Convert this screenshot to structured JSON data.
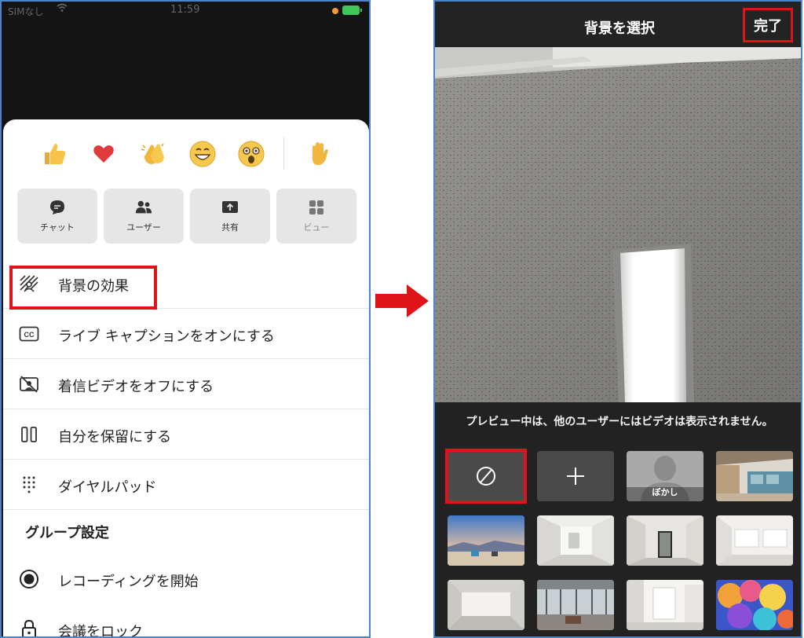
{
  "left_phone": {
    "status_bar": {
      "carrier": "SIMなし",
      "time": "11:59"
    },
    "reactions": [
      "thumbs-up",
      "heart",
      "clapping-hands",
      "laughing-face",
      "surprised-face",
      "raised-hand"
    ],
    "tiles": [
      {
        "label": "チャット",
        "icon": "chat-icon"
      },
      {
        "label": "ユーザー",
        "icon": "people-icon"
      },
      {
        "label": "共有",
        "icon": "share-icon"
      },
      {
        "label": "ビュー",
        "icon": "grid-icon",
        "disabled": true
      }
    ],
    "menu": [
      {
        "label": "背景の効果",
        "icon": "background-effects-icon"
      },
      {
        "label": "ライブ キャプションをオンにする",
        "icon": "closed-caption-icon"
      },
      {
        "label": "着信ビデオをオフにする",
        "icon": "video-off-icon"
      },
      {
        "label": "自分を保留にする",
        "icon": "pause-icon"
      },
      {
        "label": "ダイヤルパッド",
        "icon": "dialpad-icon"
      }
    ],
    "group_heading": "グループ設定",
    "group_menu": [
      {
        "label": "レコーディングを開始",
        "icon": "record-icon"
      },
      {
        "label": "会議をロック",
        "icon": "lock-icon"
      }
    ]
  },
  "right_phone": {
    "title": "背景を選択",
    "done_label": "完了",
    "notice": "プレビュー中は、他のユーザーにはビデオは表示されません。",
    "options": [
      {
        "kind": "none",
        "icon": "no-background-icon"
      },
      {
        "kind": "add",
        "icon": "plus-icon"
      },
      {
        "kind": "blur",
        "label": "ぼかし"
      },
      {
        "kind": "image",
        "name": "office-interior"
      },
      {
        "kind": "image",
        "name": "beach-sunset"
      },
      {
        "kind": "image",
        "name": "white-room"
      },
      {
        "kind": "image",
        "name": "doorway-room"
      },
      {
        "kind": "image",
        "name": "bright-room"
      },
      {
        "kind": "image",
        "name": "empty-hall"
      },
      {
        "kind": "image",
        "name": "glass-lobby"
      },
      {
        "kind": "image",
        "name": "gallery-walls"
      },
      {
        "kind": "image",
        "name": "balloons"
      }
    ]
  },
  "colors": {
    "highlight": "#e0121a",
    "frame": "#4a86c5",
    "arrow": "#e0121a"
  }
}
